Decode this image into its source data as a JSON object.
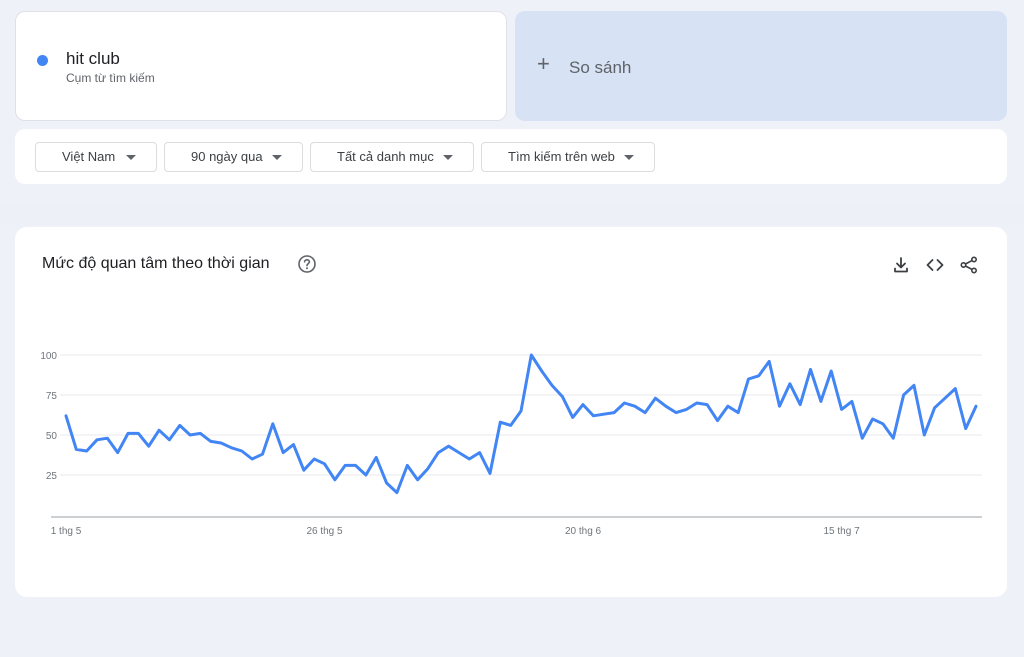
{
  "search_term": {
    "name": "hit club",
    "type": "Cụm từ tìm kiếm",
    "color": "#4285f4"
  },
  "compare": {
    "icon": "plus-icon",
    "label": "So sánh"
  },
  "filters": [
    {
      "label": "Việt Nam"
    },
    {
      "label": "90 ngày qua"
    },
    {
      "label": "Tất cả danh mục"
    },
    {
      "label": "Tìm kiếm trên web"
    }
  ],
  "chart_section": {
    "title": "Mức độ quan tâm theo thời gian",
    "help_icon": "help-circle-icon",
    "actions": [
      "download-icon",
      "embed-code-icon",
      "share-icon"
    ]
  },
  "chart_data": {
    "type": "line",
    "title": "",
    "xlabel": "",
    "ylabel": "",
    "ylim": [
      0,
      100
    ],
    "yticks": [
      25,
      50,
      75,
      100
    ],
    "x_tick_labels": [
      "1 thg 5",
      "26 thg 5",
      "20 thg 6",
      "15 thg 7"
    ],
    "x_tick_positions": [
      0,
      25,
      50,
      75
    ],
    "grid": true,
    "line_color": "#4285f4",
    "series": [
      {
        "name": "hit club",
        "values": [
          62,
          41,
          40,
          47,
          48,
          39,
          51,
          51,
          43,
          53,
          47,
          56,
          50,
          51,
          46,
          45,
          42,
          40,
          35,
          38,
          57,
          39,
          44,
          28,
          35,
          32,
          22,
          31,
          31,
          25,
          36,
          20,
          14,
          31,
          22,
          29,
          39,
          43,
          39,
          35,
          39,
          26,
          58,
          56,
          65,
          100,
          90,
          81,
          74,
          61,
          69,
          62,
          63,
          64,
          70,
          68,
          64,
          73,
          68,
          64,
          66,
          70,
          69,
          59,
          68,
          64,
          85,
          87,
          96,
          68,
          82,
          69,
          91,
          71,
          90,
          66,
          71,
          48,
          60,
          57,
          48,
          75,
          81,
          50,
          67,
          73,
          79,
          54,
          68
        ]
      }
    ]
  }
}
